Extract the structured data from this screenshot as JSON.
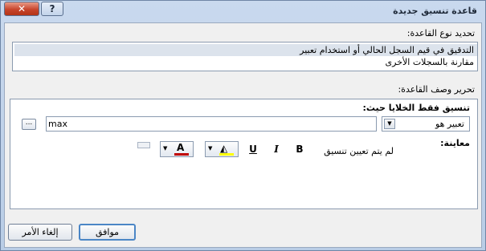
{
  "window": {
    "title": "قاعدة تنسيق جديدة",
    "close_glyph": "✕",
    "help_glyph": "?"
  },
  "rule_type": {
    "label": "تحديد نوع القاعدة:",
    "items": [
      {
        "label": "التدقيق في قيم السجل الحالي أو استخدام تعبير",
        "selected": true
      },
      {
        "label": "مقارنة بالسجلات الأخرى",
        "selected": false
      }
    ]
  },
  "rule_desc": {
    "label": "تحرير وصف القاعدة:",
    "format_cells_label": "تنسيق فقط الخلايا حيث:",
    "condition_type": "تعبير هو",
    "expression": "max",
    "builder_glyph": "...",
    "preview_label": "معاينة:",
    "preview_text": "لم يتم تعيين تنسيق",
    "tools": {
      "bold": "B",
      "italic": "I",
      "underline": "U",
      "font_color_glyph": "A",
      "font_color": "#c00000",
      "fill_color": "#ffff00"
    }
  },
  "buttons": {
    "ok": "موافق",
    "cancel": "إلغاء الأمر"
  }
}
